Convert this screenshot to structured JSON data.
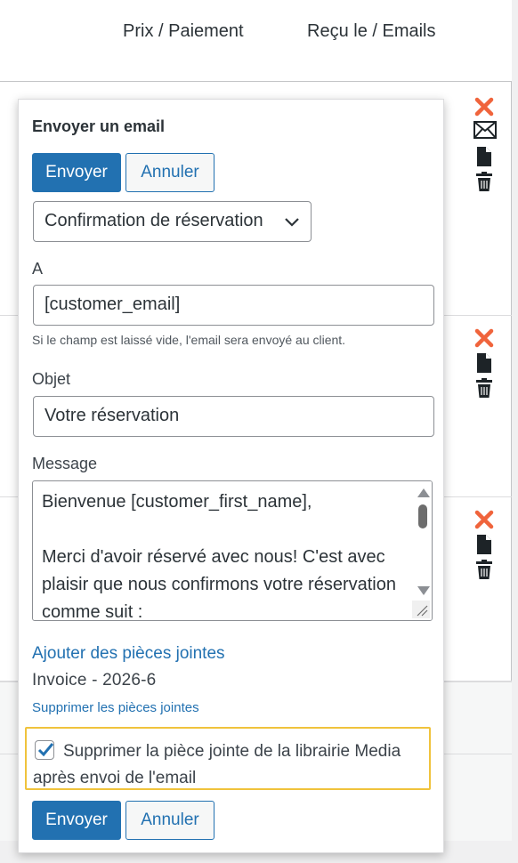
{
  "table": {
    "col_prix": "Prix / Paiement",
    "col_recu": "Reçu le / Emails"
  },
  "popup": {
    "title": "Envoyer un email",
    "send_label": "Envoyer",
    "cancel_label": "Annuler",
    "template_selected": "Confirmation de réservation",
    "to_label": "A",
    "to_value": "[customer_email]",
    "to_hint": "Si le champ est laissé vide, l'email sera envoyé au client.",
    "subject_label": "Objet",
    "subject_value": "Votre réservation",
    "message_label": "Message",
    "message_lines": [
      "Bienvenue [customer_first_name],",
      "",
      "Merci d'avoir réservé avec nous! C'est avec plaisir que nous confirmons votre réservation comme suit :"
    ],
    "add_attachments": "Ajouter des pièces jointes",
    "attachment_name": "Invoice - 2026-6",
    "remove_attachments": "Supprimer les pièces jointes",
    "delete_media_checkbox_label": "Supprimer la pièce jointe de la librairie Media après envoi de l'email",
    "delete_media_checked": true
  },
  "colors": {
    "primary": "#2271b1",
    "delete_red": "#f0643c",
    "highlight": "#f0c33c"
  },
  "icons": [
    "close-icon",
    "envelope-icon",
    "document-icon",
    "trash-icon"
  ]
}
